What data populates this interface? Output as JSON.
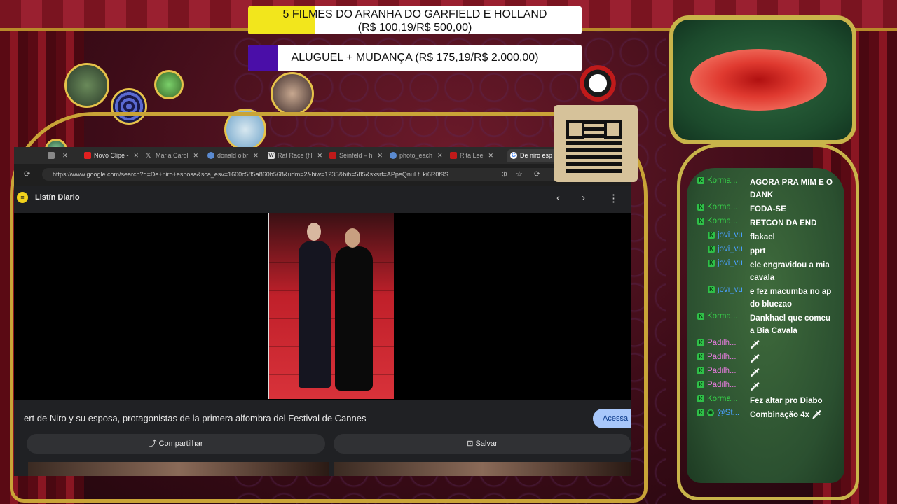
{
  "goals": {
    "goal1": {
      "title": "5 FILMES DO ARANHA DO GARFIELD E HOLLAND",
      "amount": "(R$ 100,19/R$ 500,00)",
      "progress": 0.2,
      "color": "#f2e61c"
    },
    "goal2": {
      "title": "ALUGUEL + MUDANÇA (R$ 175,19/R$ 2.000,00)",
      "progress": 0.09,
      "color": "#4a0ea8"
    }
  },
  "browser": {
    "tabs": [
      {
        "label": "",
        "icon": "globe-icon"
      },
      {
        "label": "Novo Clipe -",
        "icon": "youtube-icon"
      },
      {
        "label": "Maria Carol",
        "icon": "x-icon"
      },
      {
        "label": "donald o'br",
        "icon": "chrome-icon"
      },
      {
        "label": "Rat Race (fil",
        "icon": "wikipedia-icon"
      },
      {
        "label": "Seinfeld – h",
        "icon": "red-icon"
      },
      {
        "label": "photo_each",
        "icon": "chrome-icon"
      },
      {
        "label": "Rita Lee",
        "icon": "red-icon"
      },
      {
        "label": "De niro esp",
        "icon": "google-icon"
      }
    ],
    "url": "https://www.google.com/search?q=De+niro+esposa&sca_esv=1600c585a860b568&udm=2&biw=1235&bih=585&sxsrf=APpeQnuLfLki6R0f9S...",
    "source": "Listín Diario",
    "caption": "ert de Niro y su esposa, protagonistas de la primera alfombra del Festival de Cannes",
    "access_label": "Acessa",
    "share_label": "Compartilhar",
    "save_label": "Salvar"
  },
  "chat": {
    "messages": [
      {
        "user": "Korma...",
        "user_color": "#37d24a",
        "text": "AGORA PRA MIM E O DANK",
        "badges": 1
      },
      {
        "user": "Korma...",
        "user_color": "#37d24a",
        "text": "FODA-SE",
        "badges": 1
      },
      {
        "user": "Korma...",
        "user_color": "#37d24a",
        "text": "RETCON DA END",
        "badges": 1
      },
      {
        "user": "jovi_vu",
        "user_color": "#4aa0ff",
        "text": "flakael",
        "badges": 1
      },
      {
        "user": "jovi_vu",
        "user_color": "#4aa0ff",
        "text": "pprt",
        "badges": 1
      },
      {
        "user": "jovi_vu",
        "user_color": "#4aa0ff",
        "text": "ele engravidou a mia cavala",
        "badges": 1
      },
      {
        "user": "jovi_vu",
        "user_color": "#4aa0ff",
        "text": "e fez macumba no ap do bluezao",
        "badges": 1
      },
      {
        "user": "Korma...",
        "user_color": "#37d24a",
        "text": "Dankhael que comeu a Bia Cavala",
        "badges": 1
      },
      {
        "user": "Padilh...",
        "user_color": "#e07ad8",
        "text": "🗡",
        "badges": 1
      },
      {
        "user": "Padilh...",
        "user_color": "#e07ad8",
        "text": "🗡",
        "badges": 1
      },
      {
        "user": "Padilh...",
        "user_color": "#e07ad8",
        "text": "🗡",
        "badges": 1
      },
      {
        "user": "Padilh...",
        "user_color": "#e07ad8",
        "text": "🗡",
        "badges": 1
      },
      {
        "user": "Korma...",
        "user_color": "#37d24a",
        "text": "Fez altar pro Diabo",
        "badges": 1
      },
      {
        "user": "@St...",
        "user_color": "#4aa0ff",
        "text": "Combinação 4x 🗡",
        "badges": 2
      }
    ]
  }
}
